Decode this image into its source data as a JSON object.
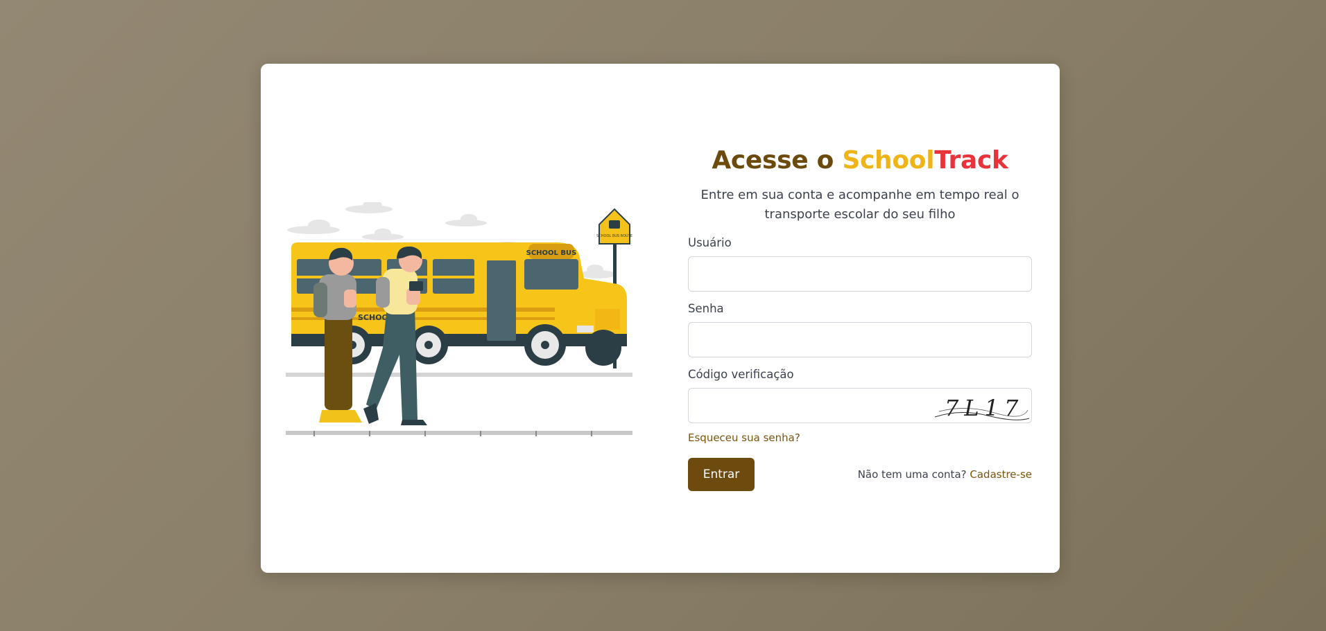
{
  "brand": {
    "title_prefix": "Acesse o ",
    "title_school": "School",
    "title_track": "Track",
    "colors": {
      "primary": "#6d4a0c",
      "school": "#efb418",
      "track": "#e8333a"
    }
  },
  "subtitle": "Entre em sua conta e acompanhe em tempo real o transporte escolar do seu filho",
  "form": {
    "username_label": "Usuário",
    "username_value": "",
    "password_label": "Senha",
    "password_value": "",
    "captcha_label": "Código verificação",
    "captcha_value": "",
    "captcha_text": "7L17",
    "forgot_link": "Esqueceu sua senha?",
    "submit_label": "Entrar",
    "signup_prompt": "Não tem uma conta?",
    "signup_link": "Cadastre-se"
  },
  "illustration": {
    "bus_label": "SCHOOL",
    "bus_sign": "SCHOOL BUS",
    "route_sign": "SCHOOL BUS ROUTE"
  }
}
